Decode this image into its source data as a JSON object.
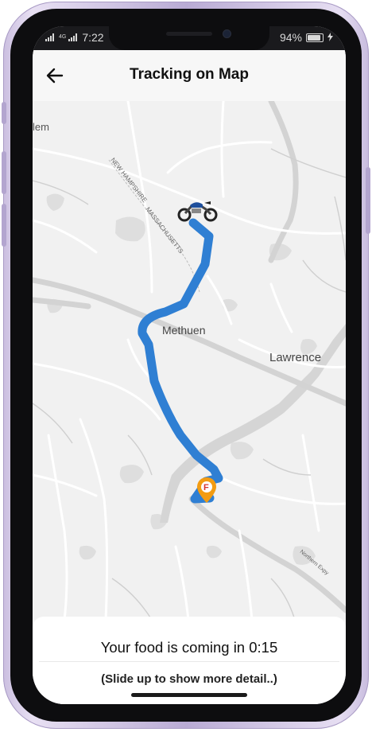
{
  "status_bar": {
    "signal_label": "4G",
    "time": "7:22",
    "battery_percent": "94%"
  },
  "header": {
    "title": "Tracking on Map"
  },
  "map": {
    "labels": {
      "partial_town": "lem",
      "state_line_nh": "NEW HAMPSHIRE",
      "state_line_ma": "MASSACHUSETTS",
      "town_methuen": "Methuen",
      "town_lawrence": "Lawrence",
      "highway": "Northern Expy"
    },
    "route_color": "#2f7fd3",
    "destination_pin_color": "#f39c12",
    "destination_icon": "restaurant-pin-icon",
    "rider_icon": "motorcycle-icon"
  },
  "bottom_panel": {
    "eta_text": "Your food is coming in 0:15",
    "hint_text": "(Slide up to show more detail..)"
  }
}
